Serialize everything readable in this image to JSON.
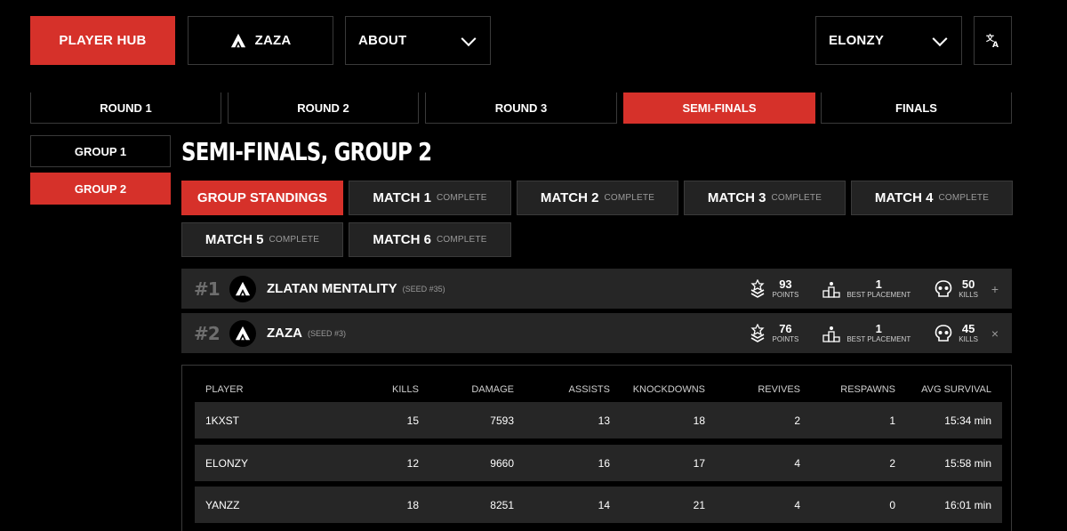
{
  "nav": {
    "player_hub": "PLAYER HUB",
    "team": "ZAZA",
    "about": "ABOUT",
    "user": "ELONZY"
  },
  "rounds": [
    "ROUND 1",
    "ROUND 2",
    "ROUND 3",
    "SEMI-FINALS",
    "FINALS"
  ],
  "active_round": "SEMI-FINALS",
  "groups": [
    "GROUP 1",
    "GROUP 2"
  ],
  "active_group": "GROUP 2",
  "title": "SEMI-FINALS, GROUP 2",
  "match_tabs": {
    "standings": "GROUP STANDINGS",
    "status": "COMPLETE",
    "matches": [
      "MATCH 1",
      "MATCH 2",
      "MATCH 3",
      "MATCH 4",
      "MATCH 5",
      "MATCH 6"
    ]
  },
  "stat_labels": {
    "points": "POINTS",
    "best_placement": "BEST PLACEMENT",
    "kills": "KILLS"
  },
  "teams": [
    {
      "rank": "#1",
      "name": "ZLATAN MENTALITY",
      "seed": "(SEED #35)",
      "points": "93",
      "best_placement": "1",
      "kills": "50",
      "toggle": "+"
    },
    {
      "rank": "#2",
      "name": "ZAZA",
      "seed": "(SEED #3)",
      "points": "76",
      "best_placement": "1",
      "kills": "45",
      "toggle": "×"
    }
  ],
  "table": {
    "headers": {
      "player": "PLAYER",
      "kills": "KILLS",
      "damage": "DAMAGE",
      "assists": "ASSISTS",
      "knockdowns": "KNOCKDOWNS",
      "revives": "REVIVES",
      "respawns": "RESPAWNS",
      "avg_survival": "AVG SURVIVAL"
    },
    "rows": [
      {
        "player": "1KXST",
        "kills": "15",
        "damage": "7593",
        "assists": "13",
        "knockdowns": "18",
        "revives": "2",
        "respawns": "1",
        "avg_survival": "15:34 min"
      },
      {
        "player": "ELONZY",
        "kills": "12",
        "damage": "9660",
        "assists": "16",
        "knockdowns": "17",
        "revives": "4",
        "respawns": "2",
        "avg_survival": "15:58 min"
      },
      {
        "player": "YANZZ",
        "kills": "18",
        "damage": "8251",
        "assists": "14",
        "knockdowns": "21",
        "revives": "4",
        "respawns": "0",
        "avg_survival": "16:01 min"
      }
    ]
  },
  "colors": {
    "accent": "#d6312a",
    "row": "#262626",
    "tab": "#232323",
    "border": "#3a3a3a"
  }
}
